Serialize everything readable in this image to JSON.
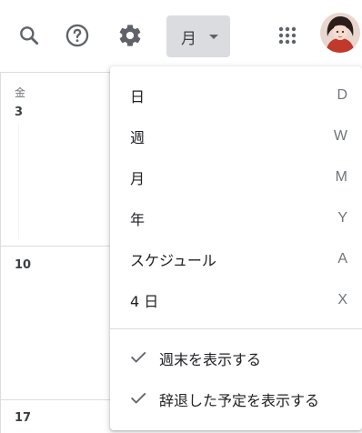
{
  "topbar": {
    "icons": {
      "search": "search-icon",
      "help": "help-icon",
      "settings": "gear-icon",
      "apps": "apps-grid-icon",
      "avatar": "avatar"
    },
    "view_select": {
      "selected": "月"
    }
  },
  "calendar": {
    "day_header": "金",
    "dates": [
      "3",
      "10",
      "17"
    ]
  },
  "menu": {
    "views": [
      {
        "label": "日",
        "shortcut": "D"
      },
      {
        "label": "週",
        "shortcut": "W"
      },
      {
        "label": "月",
        "shortcut": "M"
      },
      {
        "label": "年",
        "shortcut": "Y"
      },
      {
        "label": "スケジュール",
        "shortcut": "A"
      },
      {
        "label": "4 日",
        "shortcut": "X"
      }
    ],
    "options": [
      {
        "label": "週末を表示する",
        "checked": true
      },
      {
        "label": "辞退した予定を表示する",
        "checked": true
      }
    ]
  },
  "colors": {
    "icon": "#5f6368",
    "divider": "#dadce0",
    "select_bg": "#dadce0"
  }
}
